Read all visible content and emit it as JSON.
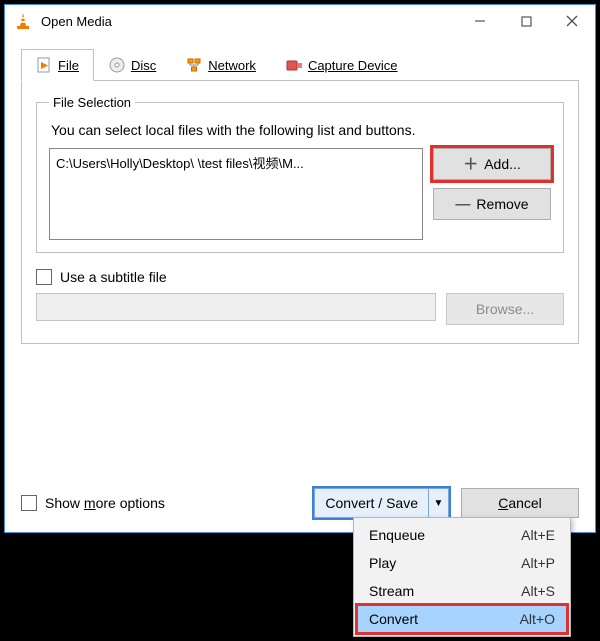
{
  "title": "Open Media",
  "tabs": {
    "file": "File",
    "disc": "Disc",
    "network": "Network",
    "capture": "Capture Device"
  },
  "fileSelection": {
    "legend": "File Selection",
    "hint": "You can select local files with the following list and buttons.",
    "entry": "C:\\Users\\Holly\\Desktop\\        \\test files\\视频\\M...",
    "add": "Add...",
    "remove": "Remove"
  },
  "subtitle": {
    "label": "Use a subtitle file",
    "browse": "Browse..."
  },
  "showMore": "Show more options",
  "convertSave": "Convert / Save",
  "cancel": "Cancel",
  "menu": {
    "enqueue": {
      "label": "Enqueue",
      "shortcut": "Alt+E"
    },
    "play": {
      "label": "Play",
      "shortcut": "Alt+P"
    },
    "stream": {
      "label": "Stream",
      "shortcut": "Alt+S"
    },
    "convert": {
      "label": "Convert",
      "shortcut": "Alt+O"
    }
  }
}
